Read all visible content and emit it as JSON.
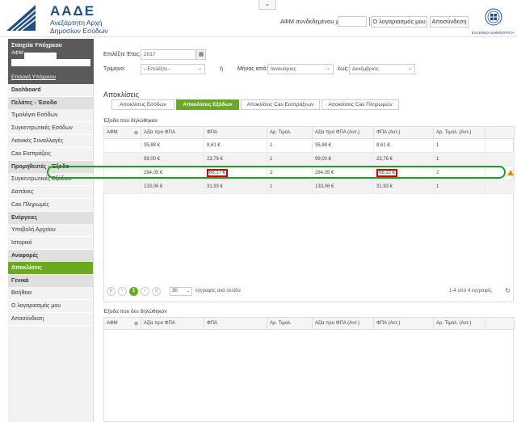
{
  "header": {
    "brand_short": "ΑΑΔΕ",
    "brand_line1": "Ανεξάρτητη Αρχή",
    "brand_line2": "Δημοσίων Εσόδων",
    "vat_label": "ΑΦΜ συνδεδεμένου χρήστη:",
    "my_account": "Ο λογαριασμός μου",
    "logout": "Αποσύνδεση",
    "emblem_text": "ΕΛΛΗΝΙΚΗ ΔΗΜΟΚΡΑΤΙΑ",
    "collapse_glyph": "⌄"
  },
  "sidebar": {
    "user_title": "Στοιχεία Υπόχρεου",
    "afm_label": "ΑΦΜ",
    "change_link": "Επιλογή Υπόχρεου",
    "items": [
      {
        "type": "item",
        "label": "Dashboard"
      },
      {
        "type": "head",
        "label": "Πελάτες - Έσοδα"
      },
      {
        "type": "item",
        "label": "Τιμολόγια Εσόδων"
      },
      {
        "type": "item",
        "label": "Συγκεντρωτικές Εσόδων"
      },
      {
        "type": "item",
        "label": "Λιανικές Συναλλαγές"
      },
      {
        "type": "item",
        "label": "Cas Εισπράξεις"
      },
      {
        "type": "head",
        "label": "Προμηθευτές - Έξοδα"
      },
      {
        "type": "item",
        "label": "Συγκεντρωτικές Εξόδων"
      },
      {
        "type": "item",
        "label": "Δαπάνες"
      },
      {
        "type": "item",
        "label": "Cas Πληρωμές"
      },
      {
        "type": "head",
        "label": "Ενέργειες"
      },
      {
        "type": "item",
        "label": "Υποβολή Αρχείου"
      },
      {
        "type": "item",
        "label": "Ιστορικό"
      },
      {
        "type": "head",
        "label": "Αναφορές"
      },
      {
        "type": "active",
        "label": "Αποκλίσεις"
      },
      {
        "type": "head",
        "label": "Γενικά"
      },
      {
        "type": "item",
        "label": "Βοήθεια"
      },
      {
        "type": "item",
        "label": "Ο λογαριασμός μου"
      },
      {
        "type": "item",
        "label": "Αποσύνδεση"
      }
    ]
  },
  "filters": {
    "year_label": "Επιλέξτε Έτος:",
    "year_value": "2017",
    "quarter_label": "Τρίμηνο:",
    "quarter_value": "--Επιλέξτε--",
    "or_label": "ή",
    "month_from_label": "Μήνας από:",
    "month_from_value": "Ιανουάριος",
    "month_to_label": "έως:",
    "month_to_value": "Δεκέμβριος"
  },
  "section_title": "Αποκλίσεις",
  "tabs": [
    {
      "label": "Αποκλίσεις Εσόδων",
      "active": false
    },
    {
      "label": "Αποκλίσεις Εξόδων",
      "active": true
    },
    {
      "label": "Αποκλίσεις Cas Εισπράξεων",
      "active": false
    },
    {
      "label": "Αποκλίσεις Cas Πληρωμών",
      "active": false
    }
  ],
  "declared": {
    "title": "Έξοδα που δηλώθηκαν",
    "columns": [
      "ΑΦΜ",
      "Αξία προ ΦΠΑ",
      "ΦΠΑ",
      "Αρ. Τιμολ.",
      "Αξία προ ΦΠΑ (Αντ.)",
      "ΦΠΑ (Αντ.)",
      "Αρ. Τιμολ. (Αντ.)",
      ""
    ],
    "rows": [
      {
        "afm": "",
        "net": "35,88 €",
        "vat": "8,61 €",
        "count": "1",
        "net_c": "35,88 €",
        "vat_c": "8,61 €",
        "count_c": "1",
        "warn": false
      },
      {
        "afm": "",
        "net": "99,00 €",
        "vat": "23,76 €",
        "count": "1",
        "net_c": "99,00 €",
        "vat_c": "23,76 €",
        "count_c": "1",
        "warn": false
      },
      {
        "afm": "",
        "net": "284,05 €",
        "vat": "68,17 €",
        "count": "2",
        "net_c": "284,05 €",
        "vat_c": "68,22 €",
        "count_c": "2",
        "warn": true
      },
      {
        "afm": "",
        "net": "133,06 €",
        "vat": "31,93 €",
        "count": "1",
        "net_c": "133,06 €",
        "vat_c": "31,93 €",
        "count_c": "1",
        "warn": false
      }
    ],
    "pager": {
      "current_page": "1",
      "page_size": "30",
      "per_page_text": "εγγραφές ανά σελίδα",
      "summary": "1-4 από 4 εγγραφές"
    }
  },
  "undeclared": {
    "title": "Έξοδα που δεν δηλώθηκαν",
    "columns": [
      "ΑΦΜ",
      "Αξία προ ΦΠΑ",
      "ΦΠΑ",
      "Αρ. Τιμολ.",
      "Αξία προ ΦΠΑ (Αντ.)",
      "ΦΠΑ (Αντ.)",
      "Αρ. Τιμολ. (Αντ.)"
    ]
  },
  "colors": {
    "accent": "#6aaa20",
    "brand": "#1f4e8c",
    "highlight_ring": "#1aa31a",
    "error_box": "#d80000"
  }
}
